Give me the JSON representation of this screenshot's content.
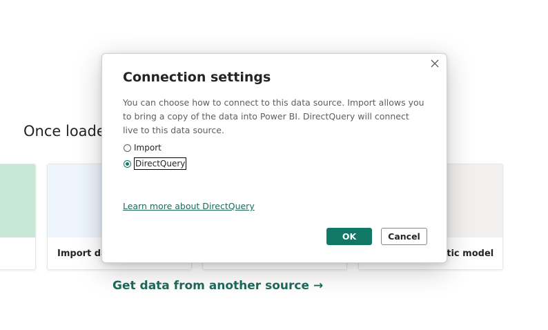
{
  "background": {
    "heading": "Once loade",
    "cards": [
      {
        "label": ""
      },
      {
        "label": "Import dat"
      },
      {
        "label": ""
      },
      {
        "label": "ntic model"
      }
    ],
    "get_data_link": "Get data from another source",
    "get_data_arrow": "→"
  },
  "dialog": {
    "title": "Connection settings",
    "description": "You can choose how to connect to this data source. Import allows you to bring a copy of the data into Power BI. DirectQuery will connect live to this data source.",
    "options": [
      {
        "label": "Import",
        "selected": false
      },
      {
        "label": "DirectQuery",
        "selected": true
      }
    ],
    "learn_more": "Learn more about DirectQuery",
    "ok_label": "OK",
    "cancel_label": "Cancel",
    "close_icon": "close-icon"
  },
  "colors": {
    "accent": "#117865",
    "link": "#1e6a5a"
  }
}
